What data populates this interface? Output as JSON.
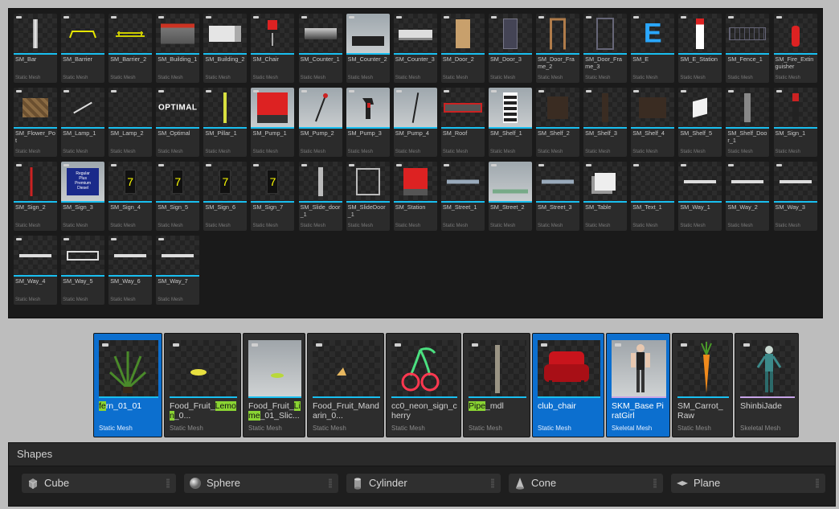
{
  "content_browser": {
    "assets": [
      {
        "name": "SM_Bar",
        "type": "Static Mesh",
        "icon": "bar-pole"
      },
      {
        "name": "SM_Barrier",
        "type": "Static Mesh",
        "icon": "barrier"
      },
      {
        "name": "SM_Barrier_2",
        "type": "Static Mesh",
        "icon": "barrier-2"
      },
      {
        "name": "SM_Building_1",
        "type": "Static Mesh",
        "icon": "building"
      },
      {
        "name": "SM_Building_2",
        "type": "Static Mesh",
        "icon": "building-white"
      },
      {
        "name": "SM_Chair",
        "type": "Static Mesh",
        "icon": "chair"
      },
      {
        "name": "SM_Counter_1",
        "type": "Static Mesh",
        "icon": "counter"
      },
      {
        "name": "SM_Counter_2",
        "type": "Static Mesh",
        "icon": "counter-light"
      },
      {
        "name": "SM_Counter_3",
        "type": "Static Mesh",
        "icon": "counter-3"
      },
      {
        "name": "SM_Door_2",
        "type": "Static Mesh",
        "icon": "door-wood"
      },
      {
        "name": "SM_Door_3",
        "type": "Static Mesh",
        "icon": "door-dark"
      },
      {
        "name": "SM_Door_Frame_2",
        "type": "Static Mesh",
        "icon": "door-frame"
      },
      {
        "name": "SM_Door_Frame_3",
        "type": "Static Mesh",
        "icon": "door-frame-dark"
      },
      {
        "name": "SM_E",
        "type": "Static Mesh",
        "icon": "letter-e"
      },
      {
        "name": "SM_E_Station",
        "type": "Static Mesh",
        "icon": "e-station"
      },
      {
        "name": "SM_Fence_1",
        "type": "Static Mesh",
        "icon": "fence"
      },
      {
        "name": "SM_Fire_Extinguisher",
        "type": "Static Mesh",
        "icon": "extinguisher"
      },
      {
        "name": "SM_Flower_Pot",
        "type": "Static Mesh",
        "icon": "flower-pot"
      },
      {
        "name": "SM_Lamp_1",
        "type": "Static Mesh",
        "icon": "lamp"
      },
      {
        "name": "SM_Lamp_2",
        "type": "Static Mesh",
        "icon": "lamp-empty"
      },
      {
        "name": "SM_Optimal",
        "type": "Static Mesh",
        "icon": "optimal-text"
      },
      {
        "name": "SM_Pillar_1",
        "type": "Static Mesh",
        "icon": "pillar"
      },
      {
        "name": "SM_Pump_1",
        "type": "Static Mesh",
        "icon": "fuel-pump"
      },
      {
        "name": "SM_Pump_2",
        "type": "Static Mesh",
        "icon": "pump-hose"
      },
      {
        "name": "SM_Pump_3",
        "type": "Static Mesh",
        "icon": "pump-nozzle"
      },
      {
        "name": "SM_Pump_4",
        "type": "Static Mesh",
        "icon": "pump-line"
      },
      {
        "name": "SM_Roof",
        "type": "Static Mesh",
        "icon": "roof"
      },
      {
        "name": "SM_Shelf_1",
        "type": "Static Mesh",
        "icon": "shelf"
      },
      {
        "name": "SM_Shelf_2",
        "type": "Static Mesh",
        "icon": "shelf-2"
      },
      {
        "name": "SM_Shelf_3",
        "type": "Static Mesh",
        "icon": "shelf-3"
      },
      {
        "name": "SM_Shelf_4",
        "type": "Static Mesh",
        "icon": "shelf-4"
      },
      {
        "name": "SM_Shelf_5",
        "type": "Static Mesh",
        "icon": "shelf-5"
      },
      {
        "name": "SM_Shelf_Door_1",
        "type": "Static Mesh",
        "icon": "shelf-door"
      },
      {
        "name": "SM_Sign_1",
        "type": "Static Mesh",
        "icon": "sign-red"
      },
      {
        "name": "SM_Sign_2",
        "type": "Static Mesh",
        "icon": "sign-2"
      },
      {
        "name": "SM_Sign_3",
        "type": "Static Mesh",
        "icon": "price-sign"
      },
      {
        "name": "SM_Sign_4",
        "type": "Static Mesh",
        "icon": "digit-sign"
      },
      {
        "name": "SM_Sign_5",
        "type": "Static Mesh",
        "icon": "digit-sign"
      },
      {
        "name": "SM_Sign_6",
        "type": "Static Mesh",
        "icon": "digit-sign"
      },
      {
        "name": "SM_Sign_7",
        "type": "Static Mesh",
        "icon": "digit-sign"
      },
      {
        "name": "SM_Slide_door_1",
        "type": "Static Mesh",
        "icon": "slide-door"
      },
      {
        "name": "SM_SlideDoor_1",
        "type": "Static Mesh",
        "icon": "slide-door-frame"
      },
      {
        "name": "SM_Station",
        "type": "Static Mesh",
        "icon": "station"
      },
      {
        "name": "SM_Street_1",
        "type": "Static Mesh",
        "icon": "street"
      },
      {
        "name": "SM_Street_2",
        "type": "Static Mesh",
        "icon": "street-light"
      },
      {
        "name": "SM_Street_3",
        "type": "Static Mesh",
        "icon": "street"
      },
      {
        "name": "SM_Table",
        "type": "Static Mesh",
        "icon": "table"
      },
      {
        "name": "SM_Text_1",
        "type": "Static Mesh",
        "icon": "empty"
      },
      {
        "name": "SM_Way_1",
        "type": "Static Mesh",
        "icon": "way"
      },
      {
        "name": "SM_Way_2",
        "type": "Static Mesh",
        "icon": "way"
      },
      {
        "name": "SM_Way_3",
        "type": "Static Mesh",
        "icon": "way"
      },
      {
        "name": "SM_Way_4",
        "type": "Static Mesh",
        "icon": "way"
      },
      {
        "name": "SM_Way_5",
        "type": "Static Mesh",
        "icon": "way-frame"
      },
      {
        "name": "SM_Way_6",
        "type": "Static Mesh",
        "icon": "way"
      },
      {
        "name": "SM_Way_7",
        "type": "Static Mesh",
        "icon": "way"
      }
    ]
  },
  "recent_assets": [
    {
      "pre": "",
      "hl": "fe",
      "post": "rn_01_01",
      "type": "Static Mesh",
      "selected": true,
      "stripe": "static",
      "icon": "fern-plant"
    },
    {
      "pre": "Food_Fruit_",
      "hl": "Lemon",
      "post": "_0...",
      "type": "Static Mesh",
      "selected": false,
      "stripe": "static",
      "icon": "lemon-slice"
    },
    {
      "pre": "Food_Fruit_",
      "hl": "Lime",
      "post": "_01_Slic...",
      "type": "Static Mesh",
      "selected": false,
      "stripe": "static",
      "icon": "lime-slice"
    },
    {
      "pre": "Food_Fruit_Mandarin_0...",
      "hl": "",
      "post": "",
      "type": "Static Mesh",
      "selected": false,
      "stripe": "static",
      "icon": "mandarin"
    },
    {
      "pre": "cc0_neon_sign_cherry",
      "hl": "",
      "post": "",
      "type": "Static Mesh",
      "selected": false,
      "stripe": "static",
      "icon": "neon-cherry"
    },
    {
      "pre": "",
      "hl": "Pipe",
      "post": "_mdl",
      "type": "Static Mesh",
      "selected": false,
      "stripe": "static",
      "icon": "pipe"
    },
    {
      "pre": "club_chair",
      "hl": "",
      "post": "",
      "type": "Static Mesh",
      "selected": true,
      "stripe": "static",
      "icon": "armchair"
    },
    {
      "pre": "SKM_Base PiratGirl",
      "hl": "",
      "post": "",
      "type": "Skeletal Mesh",
      "selected": true,
      "stripe": "skeletal",
      "icon": "pirate-girl"
    },
    {
      "pre": "SM_Carrot_Raw",
      "hl": "",
      "post": "",
      "type": "Static Mesh",
      "selected": false,
      "stripe": "static",
      "icon": "carrot"
    },
    {
      "pre": "ShinbiJade",
      "hl": "",
      "post": "",
      "type": "Skeletal Mesh",
      "selected": false,
      "stripe": "skeletal",
      "icon": "character"
    }
  ],
  "shapes_panel": {
    "title": "Shapes",
    "items": [
      {
        "label": "Cube",
        "icon": "cube-icon"
      },
      {
        "label": "Sphere",
        "icon": "sphere-icon"
      },
      {
        "label": "Cylinder",
        "icon": "cylinder-icon"
      },
      {
        "label": "Cone",
        "icon": "cone-icon"
      },
      {
        "label": "Plane",
        "icon": "plane-icon"
      }
    ]
  },
  "colors": {
    "static_mesh_stripe": "#19bff0",
    "skeletal_mesh_stripe": "#c7a4e8",
    "selection": "#0c6fcf",
    "search_highlight": "#8ad433"
  }
}
